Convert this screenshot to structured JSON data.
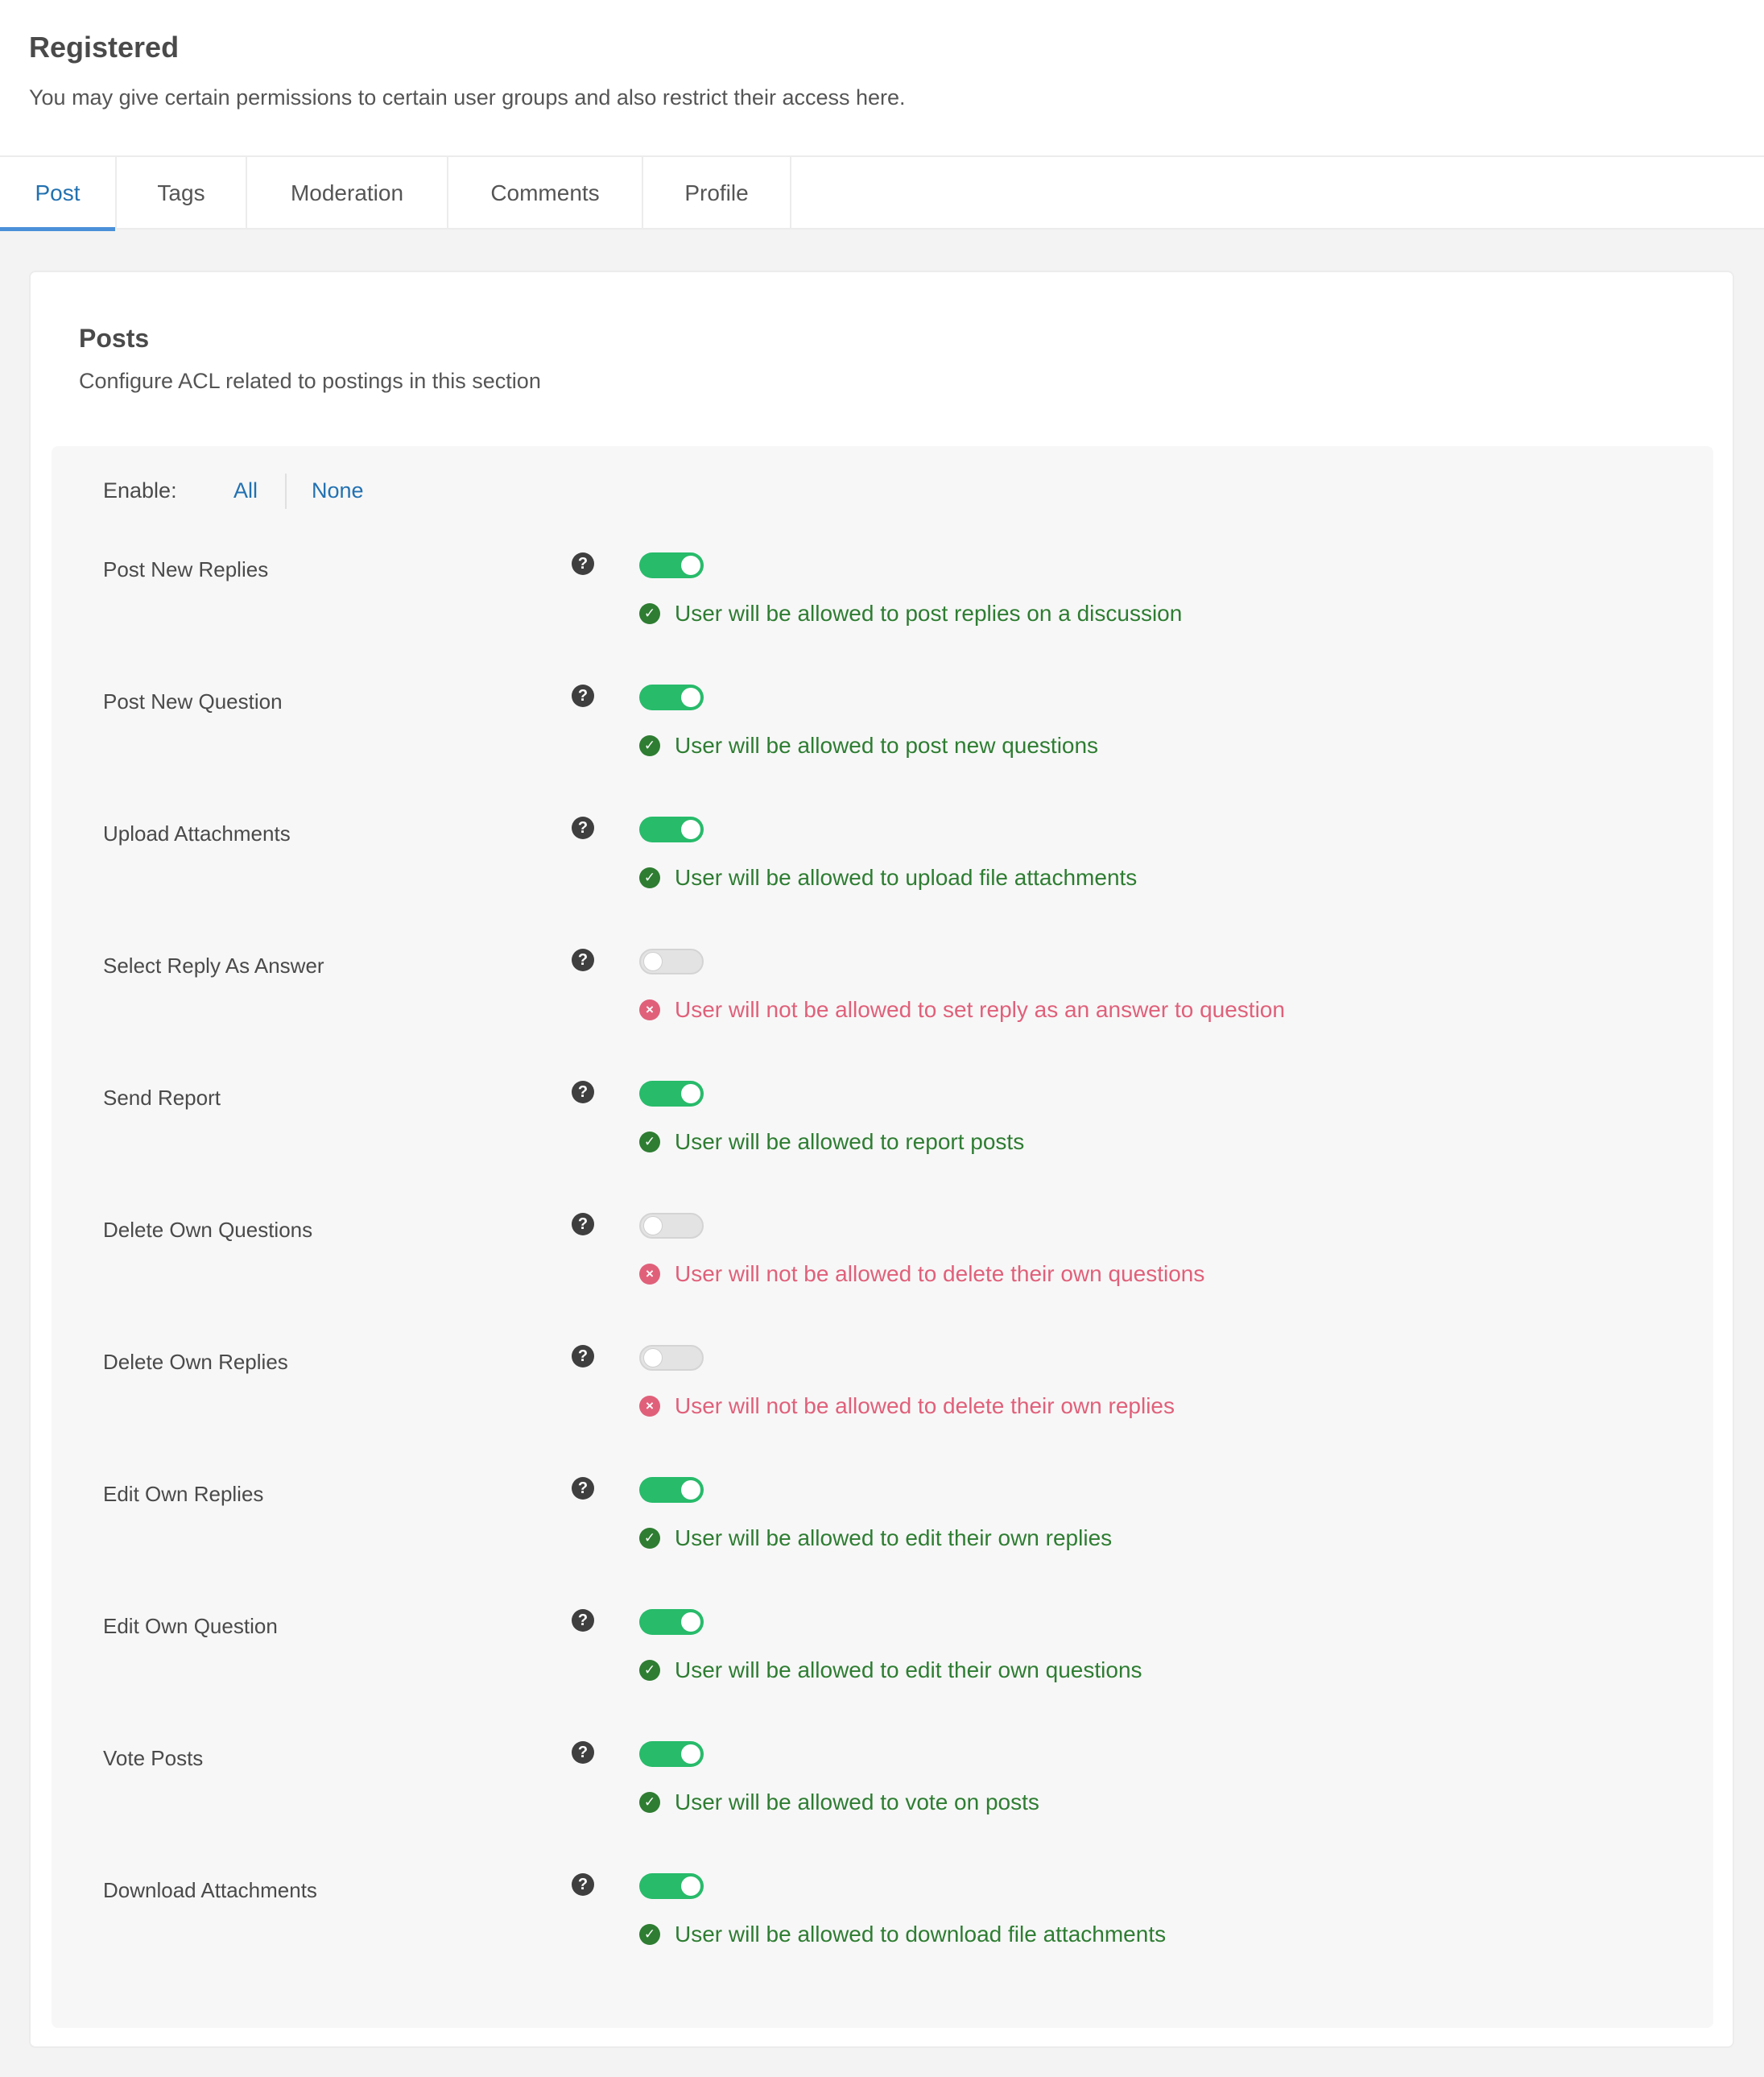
{
  "header": {
    "title": "Registered",
    "subtitle": "You may give certain permissions to certain user groups and also restrict their access here."
  },
  "tabs": [
    {
      "label": "Post",
      "active": true
    },
    {
      "label": "Tags",
      "active": false
    },
    {
      "label": "Moderation",
      "active": false
    },
    {
      "label": "Comments",
      "active": false
    },
    {
      "label": "Profile",
      "active": false
    }
  ],
  "section": {
    "title": "Posts",
    "subtitle": "Configure ACL related to postings in this section",
    "enable": {
      "label": "Enable:",
      "all": "All",
      "none": "None"
    }
  },
  "colors": {
    "accent": "#2271b1",
    "toggle_on": "#27bb6a",
    "allowed": "#2e7d32",
    "denied": "#e0607a"
  },
  "permissions": [
    {
      "label": "Post New Replies",
      "enabled": true,
      "message": "User will be allowed to post replies on a discussion"
    },
    {
      "label": "Post New Question",
      "enabled": true,
      "message": "User will be allowed to post new questions"
    },
    {
      "label": "Upload Attachments",
      "enabled": true,
      "message": "User will be allowed to upload file attachments"
    },
    {
      "label": "Select Reply As Answer",
      "enabled": false,
      "message": "User will not be allowed to set reply as an answer to question"
    },
    {
      "label": "Send Report",
      "enabled": true,
      "message": "User will be allowed to report posts"
    },
    {
      "label": "Delete Own Questions",
      "enabled": false,
      "message": "User will not be allowed to delete their own questions"
    },
    {
      "label": "Delete Own Replies",
      "enabled": false,
      "message": "User will not be allowed to delete their own replies"
    },
    {
      "label": "Edit Own Replies",
      "enabled": true,
      "message": "User will be allowed to edit their own replies"
    },
    {
      "label": "Edit Own Question",
      "enabled": true,
      "message": "User will be allowed to edit their own questions"
    },
    {
      "label": "Vote Posts",
      "enabled": true,
      "message": "User will be allowed to vote on posts"
    },
    {
      "label": "Download Attachments",
      "enabled": true,
      "message": "User will be allowed to download file attachments"
    }
  ]
}
